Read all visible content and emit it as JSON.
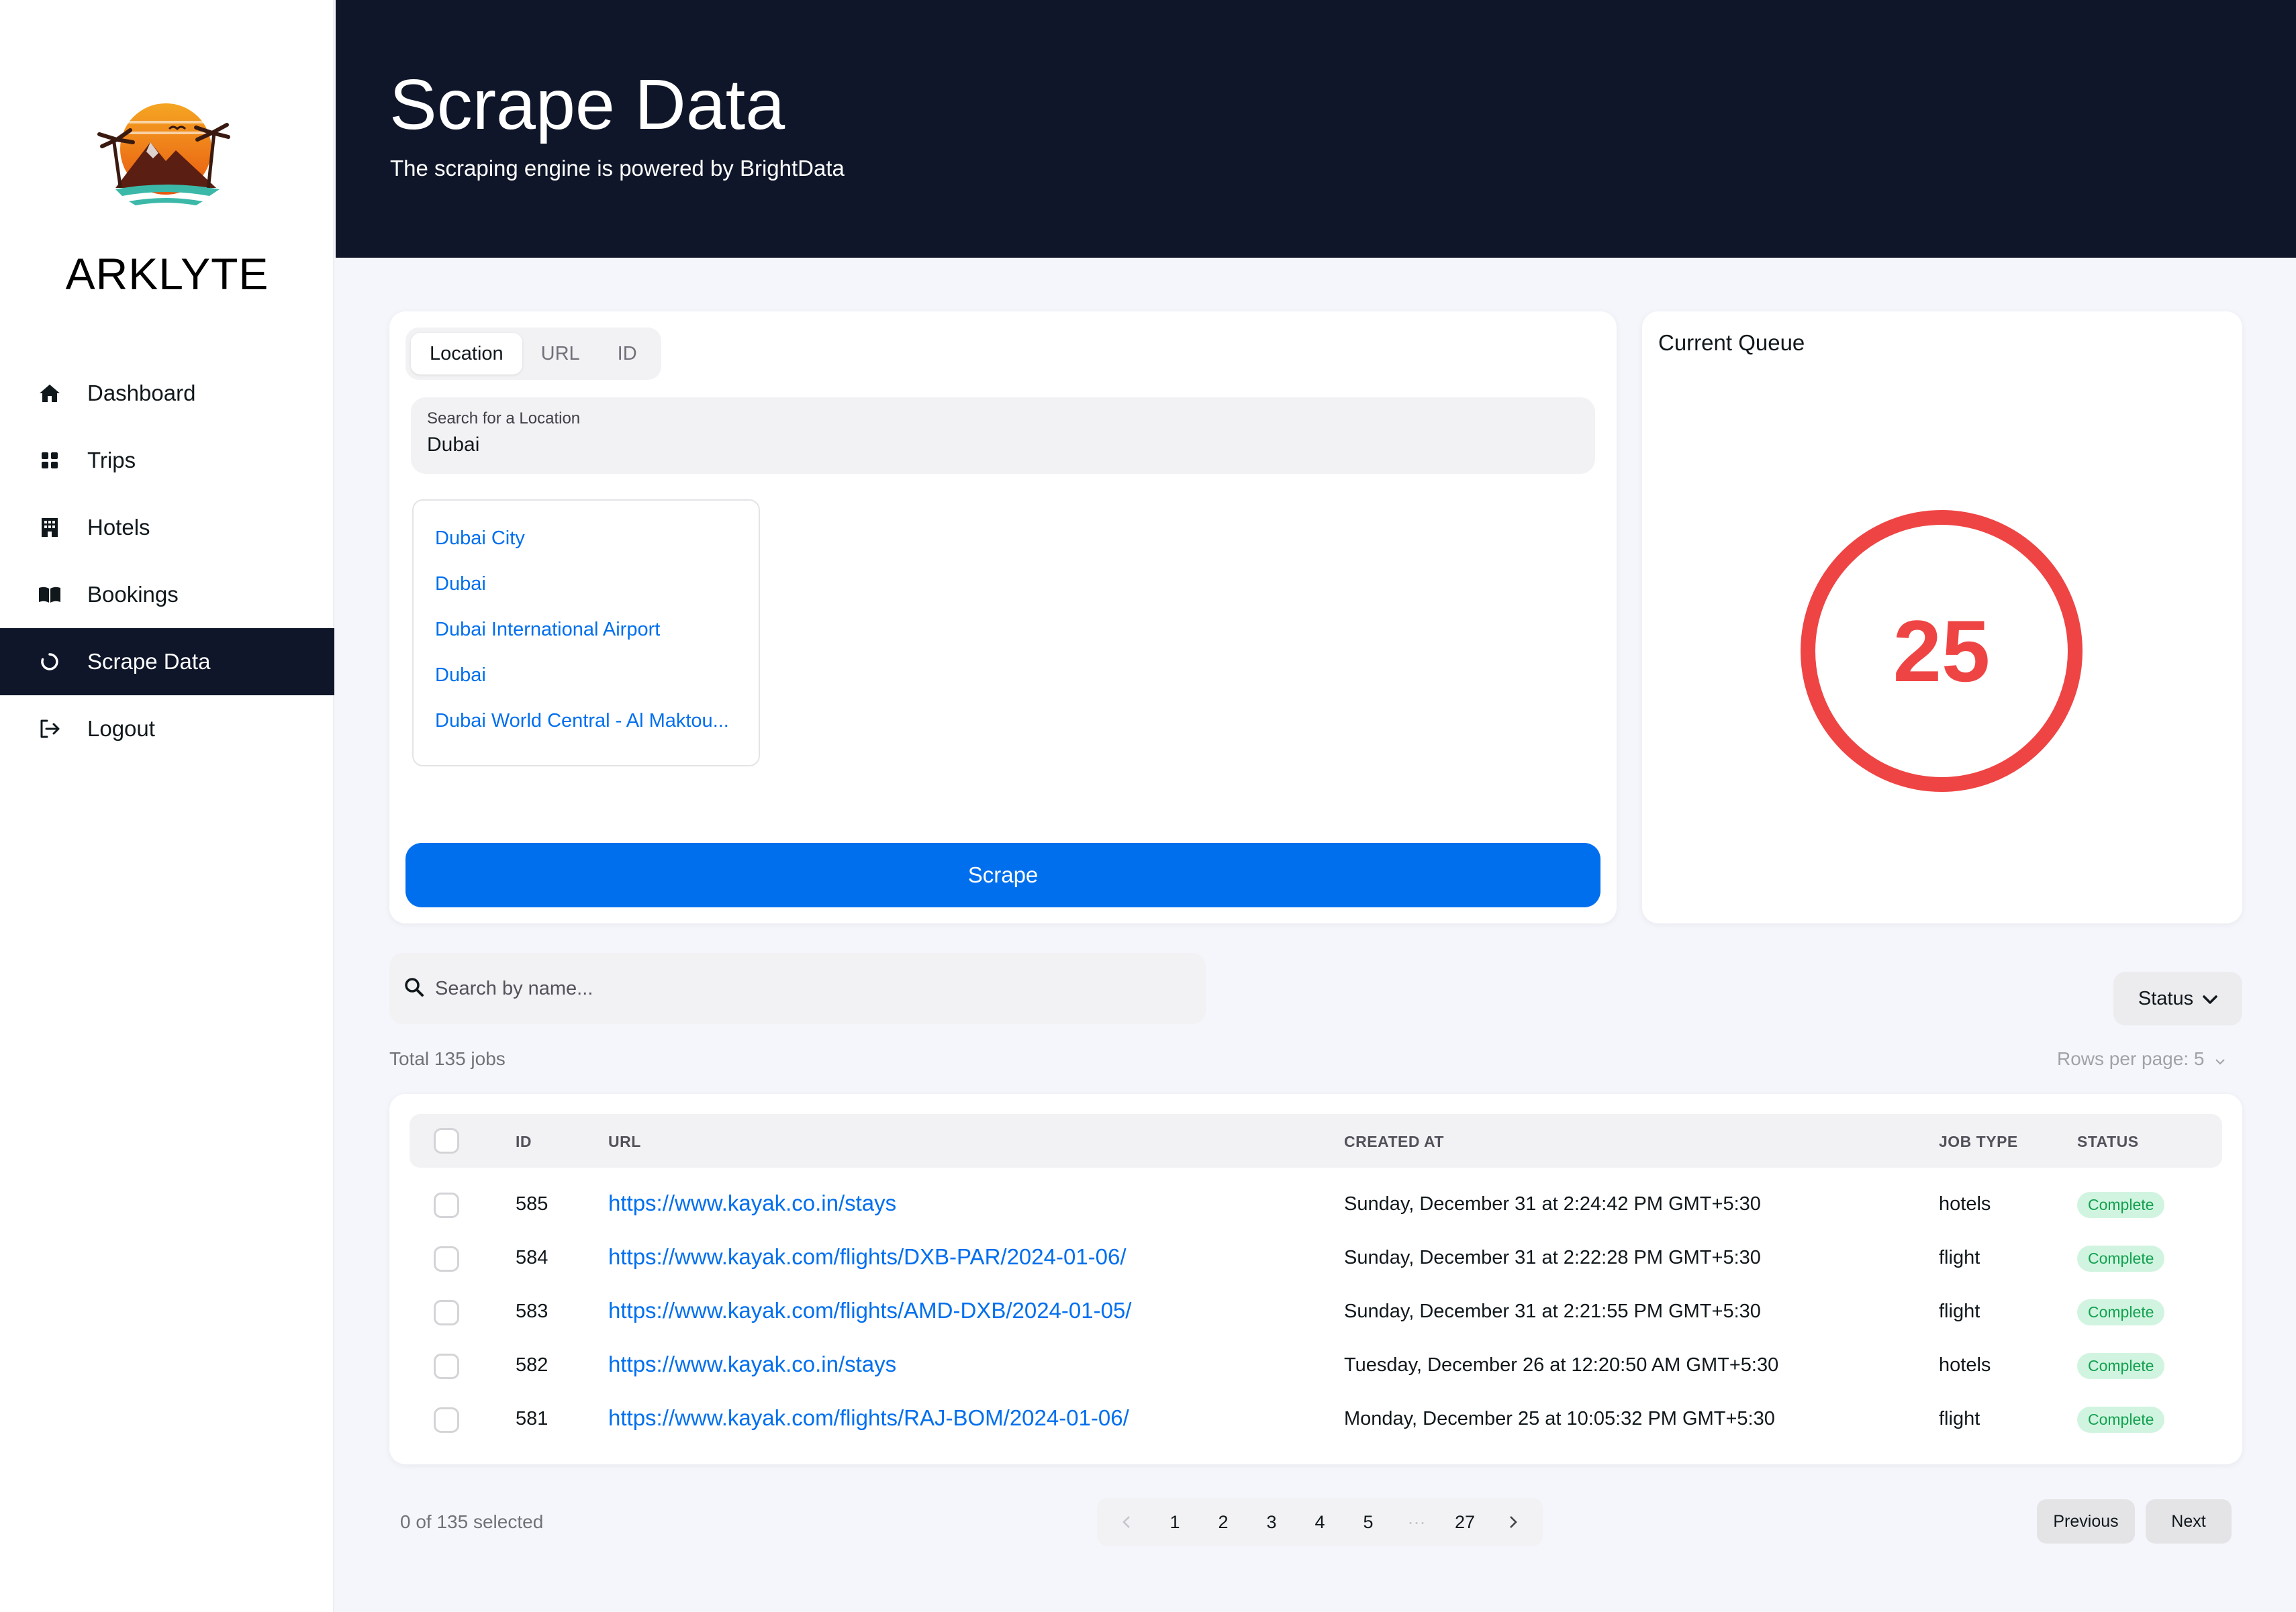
{
  "brand": {
    "name": "ARKLYTE"
  },
  "nav": {
    "items": [
      {
        "label": "Dashboard",
        "icon": "home-icon"
      },
      {
        "label": "Trips",
        "icon": "grid-icon"
      },
      {
        "label": "Hotels",
        "icon": "building-icon"
      },
      {
        "label": "Bookings",
        "icon": "book-icon"
      },
      {
        "label": "Scrape Data",
        "icon": "spinner-icon",
        "active": true
      },
      {
        "label": "Logout",
        "icon": "logout-icon"
      }
    ]
  },
  "header": {
    "title": "Scrape Data",
    "subtitle": "The scraping engine is powered by BrightData"
  },
  "scrape": {
    "tabs": [
      "Location",
      "URL",
      "ID"
    ],
    "active_tab": "Location",
    "input_label": "Search for a Location",
    "input_value": "Dubai",
    "suggestions": [
      "Dubai City",
      "Dubai",
      "Dubai International Airport",
      "Dubai",
      "Dubai World Central - Al Maktou..."
    ],
    "button_label": "Scrape"
  },
  "queue": {
    "title": "Current Queue",
    "count": "25",
    "color": "#ef4444"
  },
  "jobs": {
    "search_placeholder": "Search by name...",
    "status_filter_label": "Status",
    "total_label": "Total 135 jobs",
    "rows_per_page_label": "Rows per page: 5",
    "columns": [
      "ID",
      "URL",
      "CREATED AT",
      "JOB TYPE",
      "STATUS"
    ],
    "rows": [
      {
        "id": "585",
        "url": "https://www.kayak.co.in/stays",
        "created_at": "Sunday, December 31 at 2:24:42 PM GMT+5:30",
        "job_type": "hotels",
        "status": "Complete"
      },
      {
        "id": "584",
        "url": "https://www.kayak.com/flights/DXB-PAR/2024-01-06/",
        "created_at": "Sunday, December 31 at 2:22:28 PM GMT+5:30",
        "job_type": "flight",
        "status": "Complete"
      },
      {
        "id": "583",
        "url": "https://www.kayak.com/flights/AMD-DXB/2024-01-05/",
        "created_at": "Sunday, December 31 at 2:21:55 PM GMT+5:30",
        "job_type": "flight",
        "status": "Complete"
      },
      {
        "id": "582",
        "url": "https://www.kayak.co.in/stays",
        "created_at": "Tuesday, December 26 at 12:20:50 AM GMT+5:30",
        "job_type": "hotels",
        "status": "Complete"
      },
      {
        "id": "581",
        "url": "https://www.kayak.com/flights/RAJ-BOM/2024-01-06/",
        "created_at": "Monday, December 25 at 10:05:32 PM GMT+5:30",
        "job_type": "flight",
        "status": "Complete"
      }
    ],
    "selected_label": "0 of 135 selected",
    "pages": [
      "1",
      "2",
      "3",
      "4",
      "5",
      "···",
      "27"
    ],
    "previous_label": "Previous",
    "next_label": "Next"
  },
  "colors": {
    "primary": "#006fee",
    "dark": "#0f1629",
    "success_bg": "#d1f4e0",
    "success_text": "#12a150"
  }
}
